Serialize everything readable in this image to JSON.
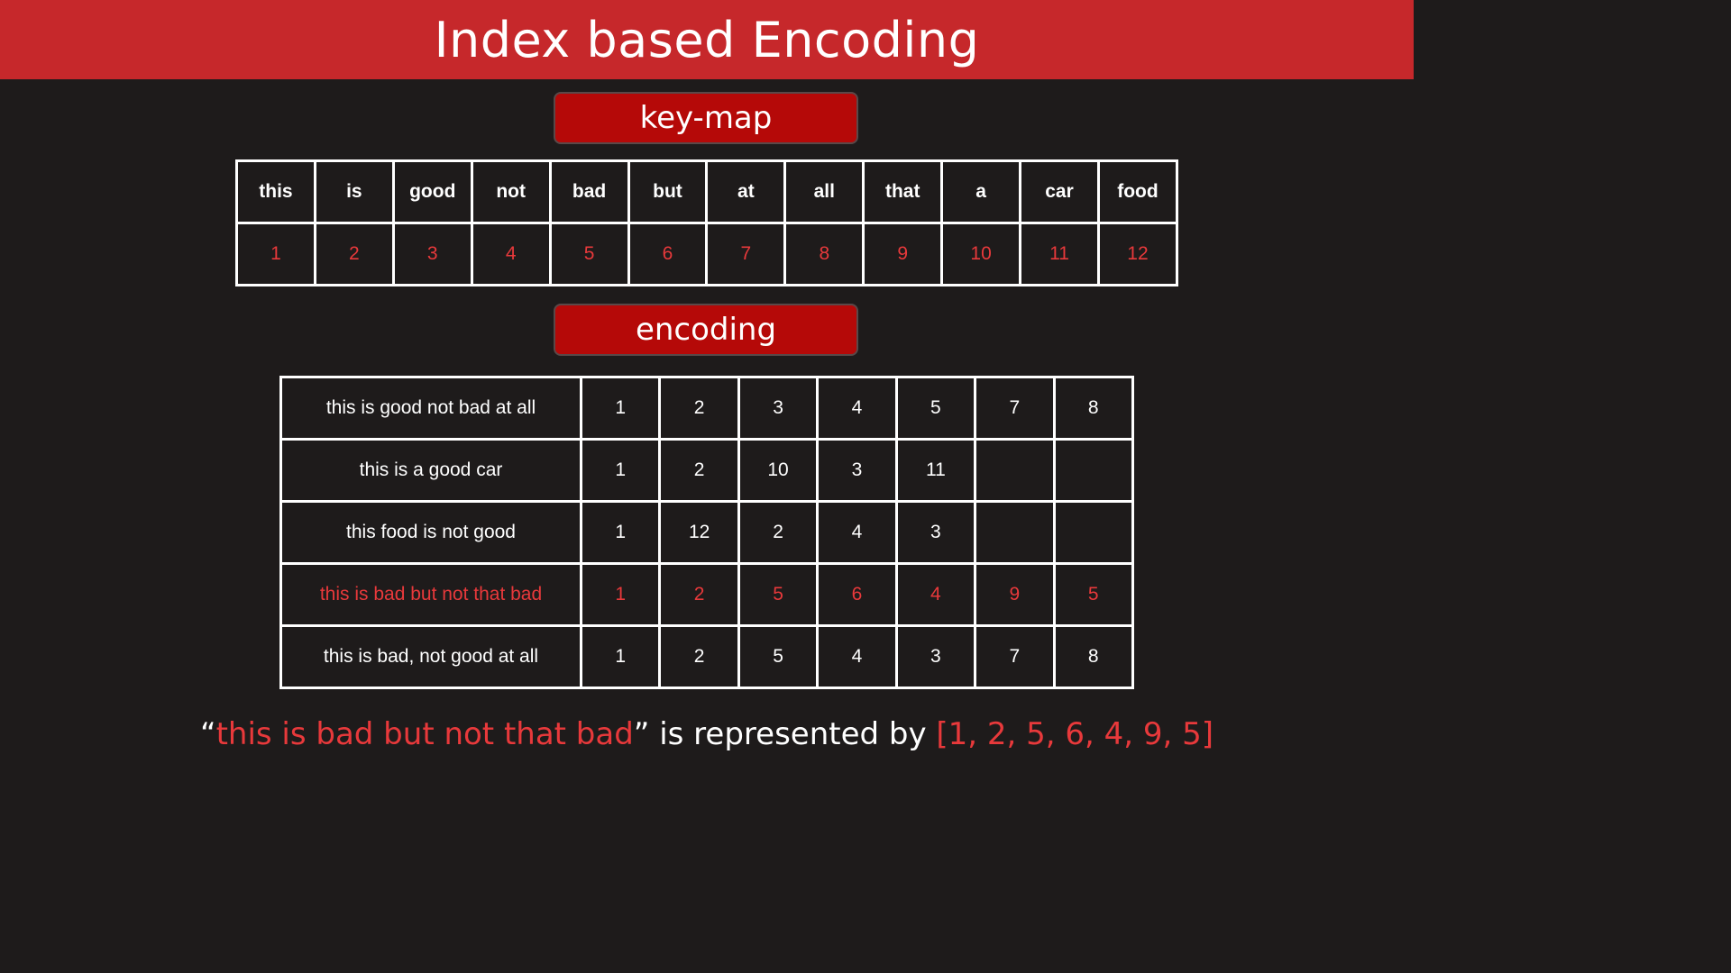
{
  "title": "Index based Encoding",
  "keymap_label": "key-map",
  "encoding_label": "encoding",
  "keymap": {
    "words": [
      "this",
      "is",
      "good",
      "not",
      "bad",
      "but",
      "at",
      "all",
      "that",
      "a",
      "car",
      "food"
    ],
    "indices": [
      "1",
      "2",
      "3",
      "4",
      "5",
      "6",
      "7",
      "8",
      "9",
      "10",
      "11",
      "12"
    ]
  },
  "encoding_rows": [
    {
      "sentence": "this is good not bad at all",
      "codes": [
        "1",
        "2",
        "3",
        "4",
        "5",
        "7",
        "8"
      ],
      "highlight": false
    },
    {
      "sentence": "this is a good car",
      "codes": [
        "1",
        "2",
        "10",
        "3",
        "11",
        "",
        ""
      ],
      "highlight": false
    },
    {
      "sentence": "this food is not good",
      "codes": [
        "1",
        "12",
        "2",
        "4",
        "3",
        "",
        ""
      ],
      "highlight": false
    },
    {
      "sentence": "this is bad but not that bad",
      "codes": [
        "1",
        "2",
        "5",
        "6",
        "4",
        "9",
        "5"
      ],
      "highlight": true
    },
    {
      "sentence": "this is bad, not good at all",
      "codes": [
        "1",
        "2",
        "5",
        "4",
        "3",
        "7",
        "8"
      ],
      "highlight": false
    }
  ],
  "caption": {
    "open_quote": "“",
    "sentence": "this is bad but not that bad",
    "close_text": "” is represented by ",
    "vector": "[1, 2, 5, 6, 4, 9, 5]"
  },
  "colors": {
    "title_bar": "#c6282b",
    "pill": "#b50908",
    "accent_red": "#e8393b",
    "background": "#1e1b1b"
  }
}
